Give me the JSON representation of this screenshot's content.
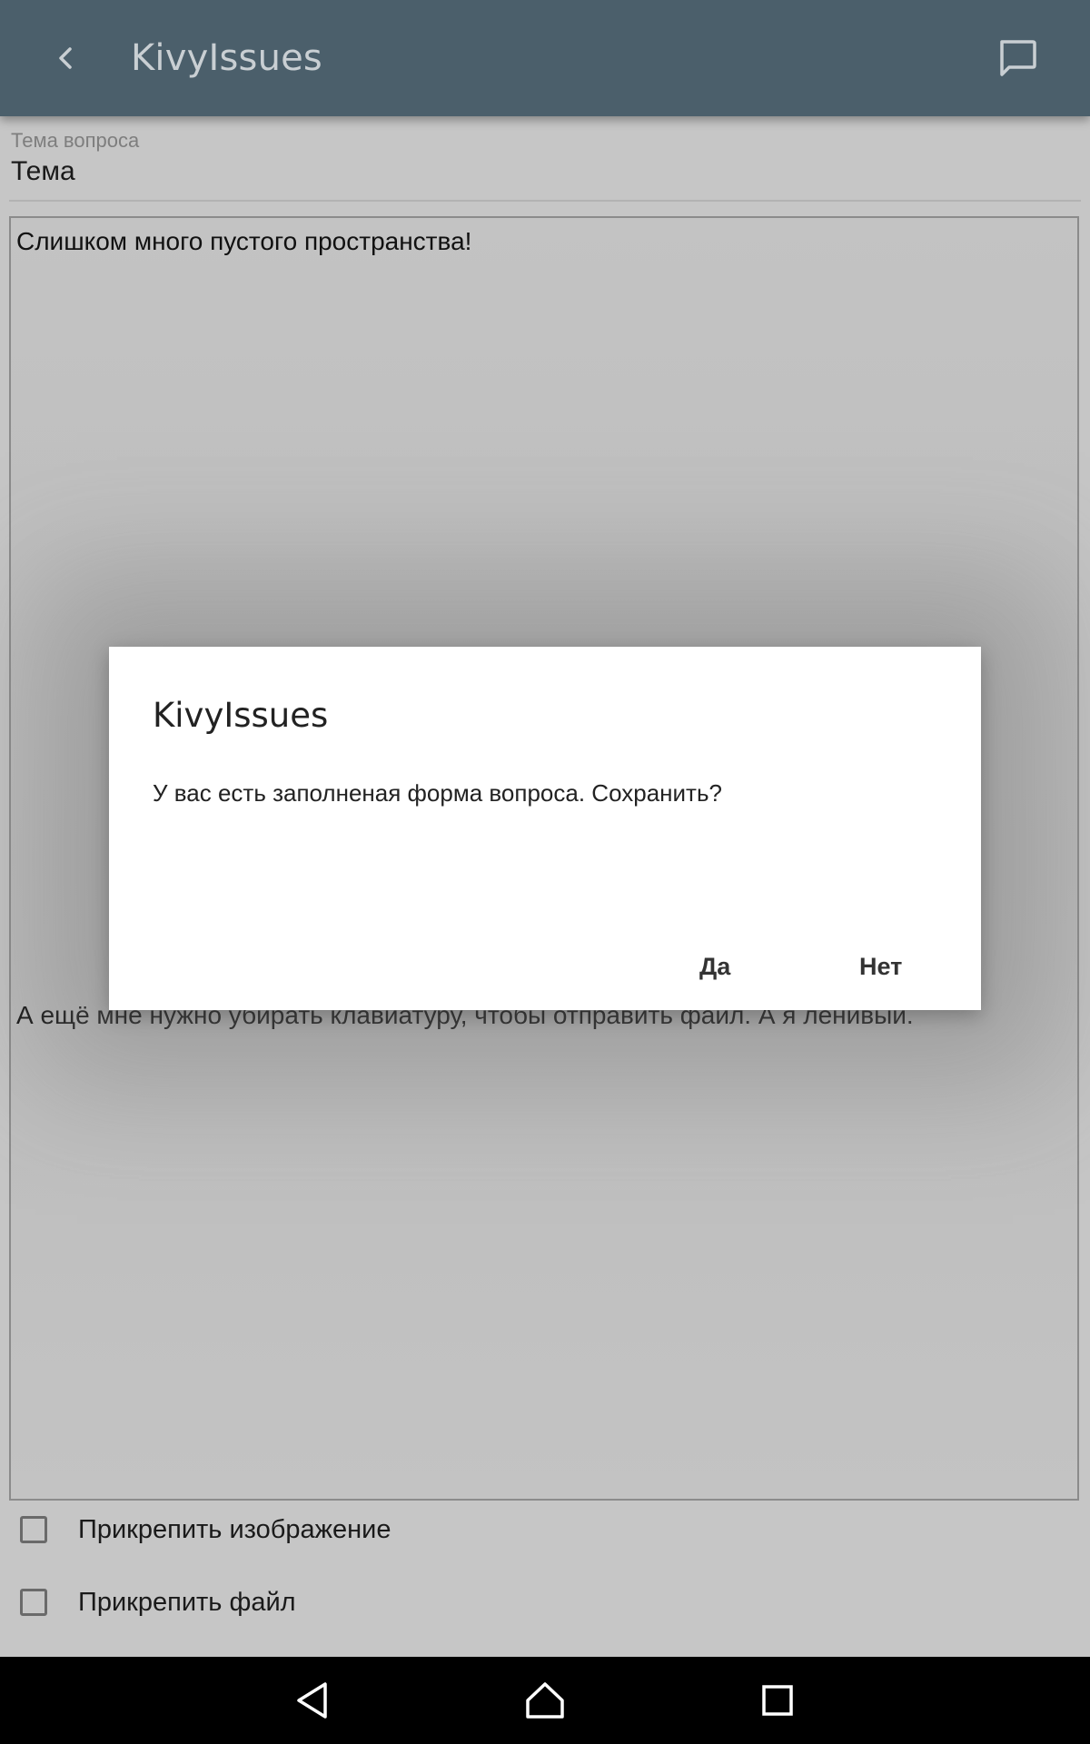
{
  "appbar": {
    "title": "KivyIssues",
    "back_icon": "chevron-left-icon",
    "chat_icon": "chat-bubble-icon",
    "color": "#4b5f6b"
  },
  "form": {
    "subject_label": "Тема вопроса",
    "subject_value": "Тема",
    "body_line_1": "Слишком много пустого пространства!",
    "body_line_2": "А ещё мне нужно убирать клавиатуру, чтобы отправить файл. А я ленивый.",
    "attach_image_label": "Прикрепить изображение",
    "attach_file_label": "Прикрепить файл"
  },
  "dialog": {
    "title": "KivyIssues",
    "message": "У вас есть заполненая форма вопроса. Сохранить?",
    "yes_label": "Да",
    "no_label": "Нет"
  },
  "navbar": {
    "back_icon": "nav-back-icon",
    "home_icon": "nav-home-icon",
    "recent_icon": "nav-recents-icon"
  }
}
